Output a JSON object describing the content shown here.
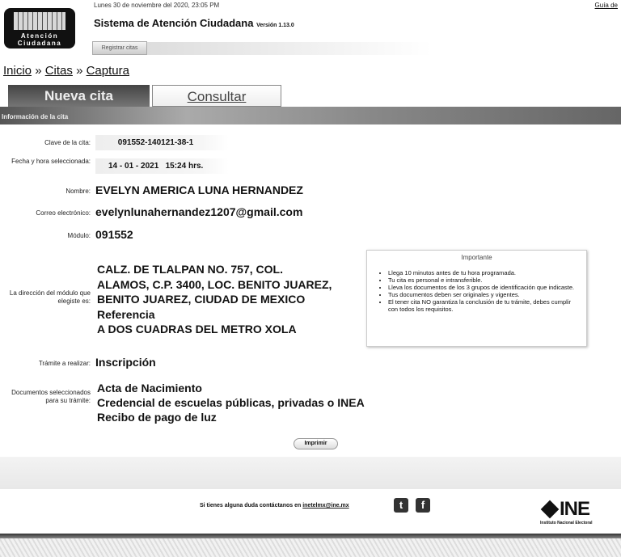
{
  "header": {
    "logo_text": "Atención Ciudadana",
    "date": "Lunes 30 de noviembre del 2020, 23:05 PM",
    "title": "Sistema de Atención Ciudadana",
    "version": "Versión 1.13.0",
    "guide_link": "Guía de",
    "register_button": "Registrar citas"
  },
  "breadcrumb": {
    "items": [
      "Inicio",
      "Citas",
      "Captura"
    ],
    "sep": "»"
  },
  "tabs": [
    "Nueva cita",
    "Consultar"
  ],
  "section_title": "Información de la cita",
  "fields": {
    "clave_label": "Clave de la cita:",
    "clave": "091552-140121-38-1",
    "fecha_label": "Fecha y hora seleccionada:",
    "fecha": "14 - 01 - 2021   15:24 hrs.",
    "nombre_label": "Nombre:",
    "nombre": "EVELYN AMERICA LUNA HERNANDEZ",
    "correo_label": "Correo electrónico:",
    "correo": "evelynlunahernandez1207@gmail.com",
    "modulo_label": "Módulo:",
    "modulo": "091552",
    "direccion_label": "La dirección del módulo que elegiste es:",
    "direccion": [
      "CALZ. DE TLALPAN NO. 757, COL.",
      "ALAMOS, C.P. 3400, LOC. BENITO JUAREZ,",
      "BENITO JUAREZ, CIUDAD DE MEXICO",
      "Referencia",
      "A DOS CUADRAS DEL METRO XOLA"
    ],
    "tramite_label": "Trámite a realizar:",
    "tramite": "Inscripción",
    "docs_label": "Documentos seleccionados para su trámite:",
    "docs": [
      "Acta de Nacimiento",
      "Credencial de escuelas públicas, privadas o INEA",
      "Recibo de pago de luz"
    ]
  },
  "important": {
    "title": "Importante",
    "items": [
      "Llega 10 minutos antes de tu hora programada.",
      "Tu cita es personal e intransferible.",
      "Lleva los documentos de los 3 grupos de identificación que indicaste.",
      "Tus documentos deben ser originales y vigentes.",
      "El tener cita NO garantiza la conclusión de tu trámite, debes cumplir con todos los requisitos."
    ]
  },
  "print_button": "Imprimir",
  "footer": {
    "text": "Si tienes alguna duda contáctanos en",
    "email": "inetelmx@ine.mx",
    "ine": "INE",
    "ine_sub": "Instituto Nacional Electoral"
  }
}
